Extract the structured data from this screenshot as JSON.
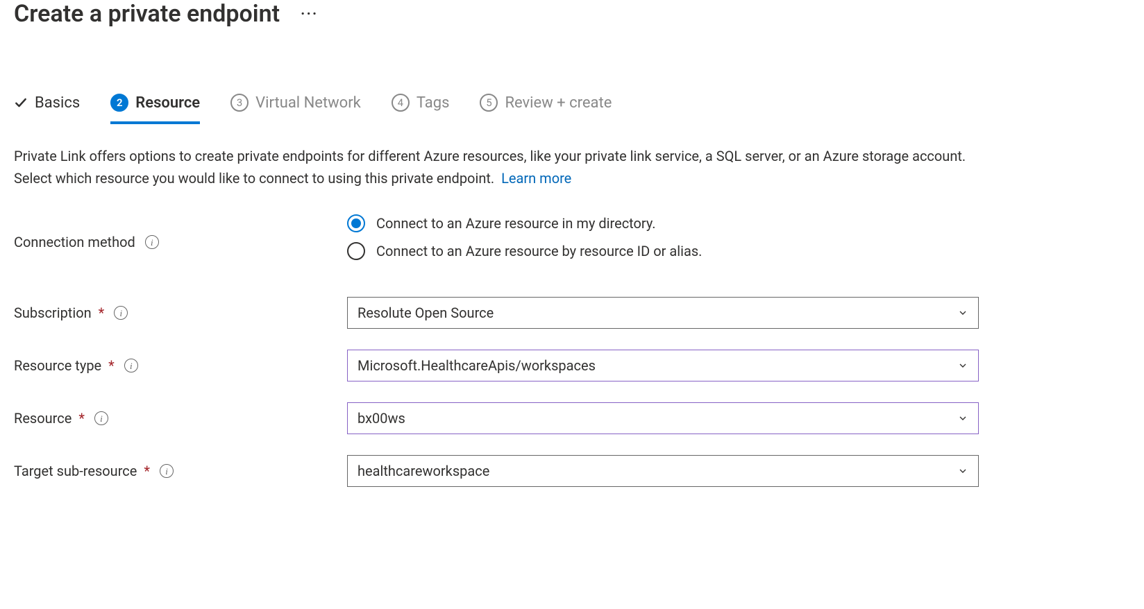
{
  "header": {
    "title": "Create a private endpoint"
  },
  "tabs": {
    "basics": "Basics",
    "resource_num": "2",
    "resource": "Resource",
    "vnet_num": "3",
    "vnet": "Virtual Network",
    "tags_num": "4",
    "tags": "Tags",
    "review_num": "5",
    "review": "Review + create"
  },
  "description": {
    "text": "Private Link offers options to create private endpoints for different Azure resources, like your private link service, a SQL server, or an Azure storage account. Select which resource you would like to connect to using this private endpoint.",
    "learn_more": "Learn more"
  },
  "form": {
    "connection_method_label": "Connection method",
    "radio_directory": "Connect to an Azure resource in my directory.",
    "radio_alias": "Connect to an Azure resource by resource ID or alias.",
    "subscription_label": "Subscription",
    "subscription_value": "Resolute Open Source",
    "resource_type_label": "Resource type",
    "resource_type_value": "Microsoft.HealthcareApis/workspaces",
    "resource_label": "Resource",
    "resource_value": "bx00ws",
    "target_sub_label": "Target sub-resource",
    "target_sub_value": "healthcareworkspace"
  }
}
